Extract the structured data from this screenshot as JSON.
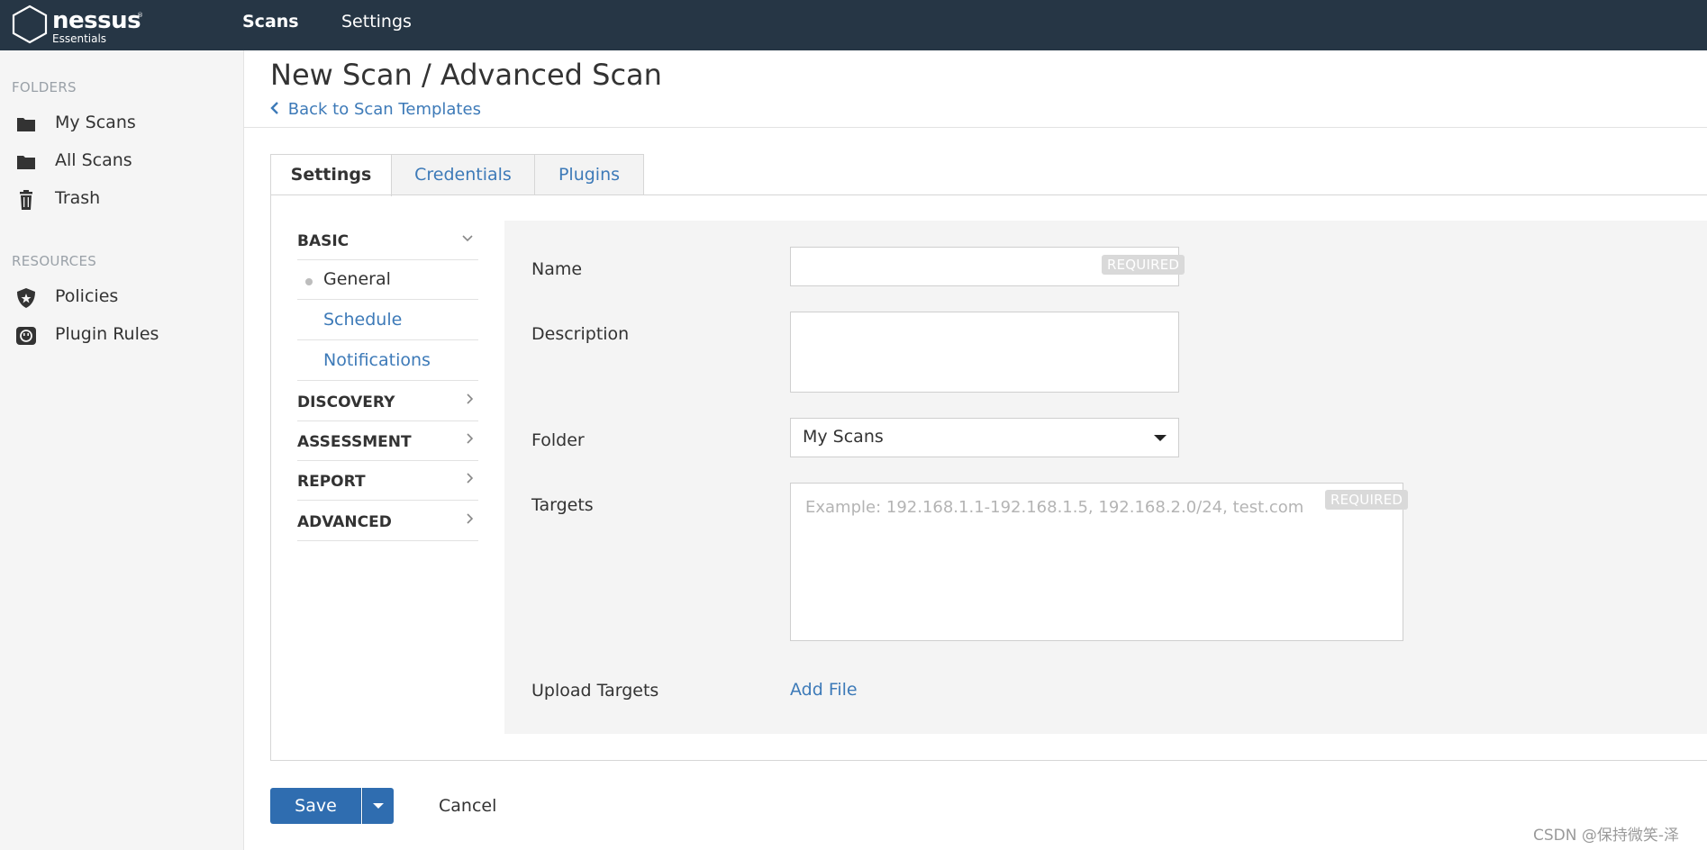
{
  "brand": {
    "name": "nessus",
    "trademark": "®",
    "edition": "Essentials"
  },
  "topnav": {
    "items": [
      {
        "label": "Scans"
      },
      {
        "label": "Settings"
      }
    ]
  },
  "sidebar": {
    "folders_heading": "FOLDERS",
    "folders": [
      {
        "label": "My Scans",
        "icon": "folder-icon"
      },
      {
        "label": "All Scans",
        "icon": "folder-icon"
      },
      {
        "label": "Trash",
        "icon": "trash-icon"
      }
    ],
    "resources_heading": "RESOURCES",
    "resources": [
      {
        "label": "Policies",
        "icon": "shield-icon"
      },
      {
        "label": "Plugin Rules",
        "icon": "plugin-rules-icon"
      }
    ]
  },
  "header": {
    "title": "New Scan / Advanced Scan",
    "back_link": "Back to Scan Templates"
  },
  "tabs": [
    {
      "label": "Settings"
    },
    {
      "label": "Credentials"
    },
    {
      "label": "Plugins"
    }
  ],
  "subnav": {
    "basic": "BASIC",
    "basic_items": [
      {
        "label": "General"
      },
      {
        "label": "Schedule"
      },
      {
        "label": "Notifications"
      }
    ],
    "sections": [
      {
        "label": "DISCOVERY"
      },
      {
        "label": "ASSESSMENT"
      },
      {
        "label": "REPORT"
      },
      {
        "label": "ADVANCED"
      }
    ]
  },
  "form": {
    "name_label": "Name",
    "name_value": "",
    "required_badge": "REQUIRED",
    "description_label": "Description",
    "description_value": "",
    "folder_label": "Folder",
    "folder_value": "My Scans",
    "targets_label": "Targets",
    "targets_placeholder": "Example: 192.168.1.1-192.168.1.5, 192.168.2.0/24, test.com",
    "upload_label": "Upload Targets",
    "add_file": "Add File"
  },
  "actions": {
    "save": "Save",
    "cancel": "Cancel"
  },
  "watermark": "CSDN @保持微笑-泽",
  "colors": {
    "topbar": "#263645",
    "link": "#3d7ab8",
    "primary_button": "#2f6db0"
  }
}
